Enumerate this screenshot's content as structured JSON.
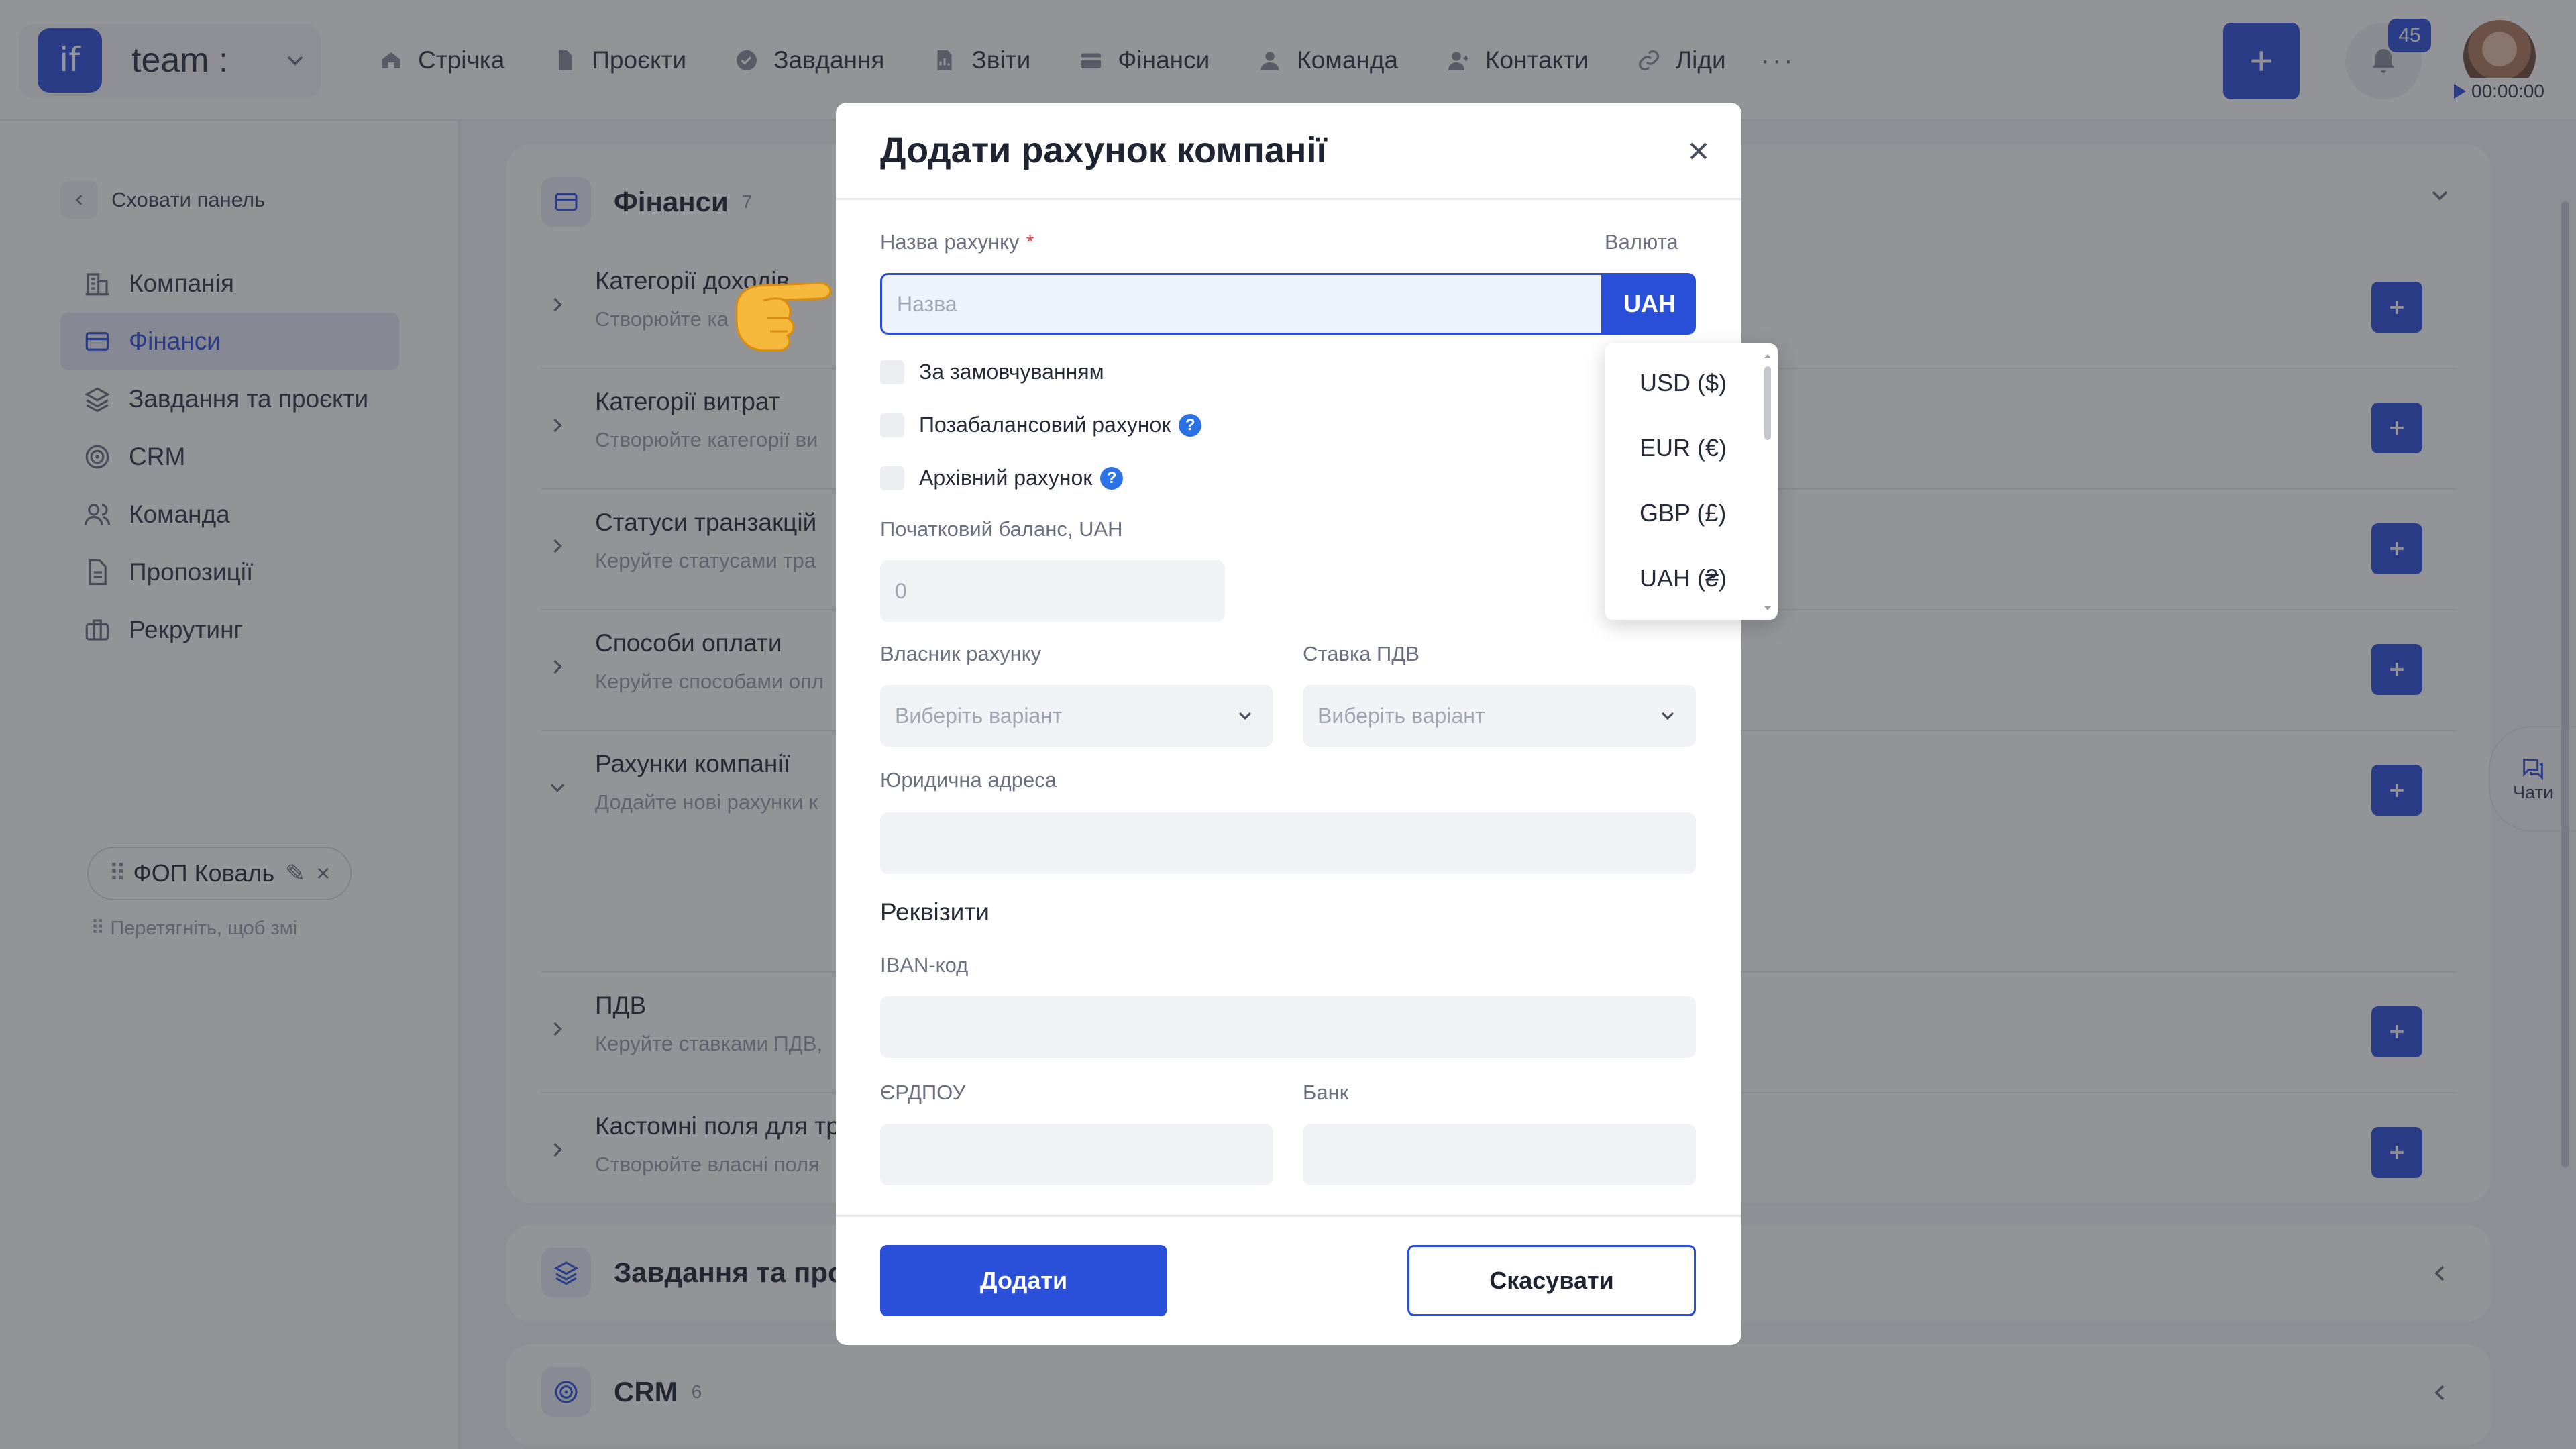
{
  "topbar": {
    "logo": "if",
    "team_name": "team :",
    "nav": [
      "Стрічка",
      "Проєкти",
      "Завдання",
      "Звіти",
      "Фінанси",
      "Команда",
      "Контакти",
      "Ліди"
    ],
    "more": "···",
    "notifications": "45",
    "timer": "00:00:00"
  },
  "sidebar": {
    "hide_panel": "Сховати панель",
    "items": [
      "Компанія",
      "Фінанси",
      "Завдання та проєкти",
      "CRM",
      "Команда",
      "Пропозиції",
      "Рекрутинг"
    ]
  },
  "finance_card": {
    "title": "Фінанси",
    "count": "7",
    "rows": [
      {
        "title": "Категорії доходів",
        "subtitle": "Створюйте ка"
      },
      {
        "title": "Категорії витрат",
        "subtitle": "Створюйте категорії ви"
      },
      {
        "title": "Статуси транзакцій",
        "subtitle": "Керуйте статусами тра"
      },
      {
        "title": "Способи оплати",
        "subtitle": "Керуйте способами опл"
      },
      {
        "title": "Рахунки компанії",
        "subtitle": "Додайте нові рахунки к"
      },
      {
        "title": "ПДВ",
        "subtitle": "Керуйте ставками ПДВ,"
      },
      {
        "title": "Кастомні поля для тр",
        "subtitle": "Створюйте власні поля"
      }
    ],
    "chip": "ФОП Коваль",
    "drag_hint": "Перетягніть, щоб змі"
  },
  "card2": {
    "title": "Завдання та про"
  },
  "card3": {
    "title": "CRM",
    "count": "6"
  },
  "chats": "Чати",
  "modal": {
    "title": "Додати рахунок компанії",
    "name_label": "Назва рахунку",
    "required_mark": "*",
    "currency_label": "Валюта",
    "name_placeholder": "Назва",
    "currency_value": "UAH",
    "checkboxes": [
      "За замовчуванням",
      "Позабалансовий рахунок",
      "Архівний рахунок"
    ],
    "help_glyph": "?",
    "balance_label": "Початковий баланс, UAH",
    "balance_placeholder": "0",
    "owner_label": "Власник рахунку",
    "owner_placeholder": "Виберіть варіант",
    "vat_label": "Ставка ПДВ",
    "vat_placeholder": "Виберіть варіант",
    "address_label": "Юридична адреса",
    "requisites": "Реквізити",
    "iban_label": "IBAN-код",
    "edrpou_label": "ЄРДПОУ",
    "bank_label": "Банк",
    "add_button": "Додати",
    "cancel_button": "Скасувати"
  },
  "currency_dropdown": [
    "USD ($)",
    "EUR (€)",
    "GBP (£)",
    "UAH (₴)"
  ],
  "colors": {
    "accent": "#2a4fd8",
    "overlay": "rgba(40,42,50,0.5)"
  }
}
